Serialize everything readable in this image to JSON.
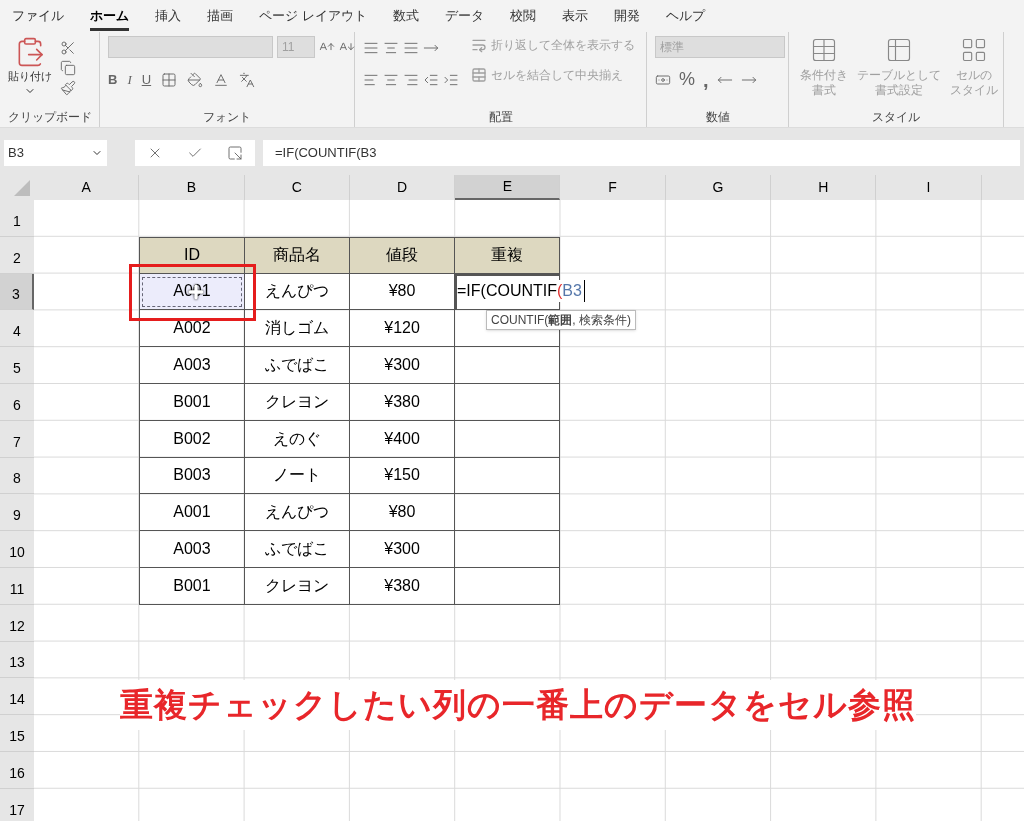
{
  "menu_tabs": [
    {
      "label": "ファイル",
      "selected": false
    },
    {
      "label": "ホーム",
      "selected": true
    },
    {
      "label": "挿入",
      "selected": false
    },
    {
      "label": "描画",
      "selected": false
    },
    {
      "label": "ページ レイアウト",
      "selected": false
    },
    {
      "label": "数式",
      "selected": false
    },
    {
      "label": "データ",
      "selected": false
    },
    {
      "label": "校閲",
      "selected": false
    },
    {
      "label": "表示",
      "selected": false
    },
    {
      "label": "開発",
      "selected": false
    },
    {
      "label": "ヘルプ",
      "selected": false
    }
  ],
  "ribbon": {
    "clipboard": {
      "paste": "貼り付け",
      "label": "クリップボード"
    },
    "font": {
      "size": "11",
      "styles": [
        "B",
        "I",
        "U"
      ],
      "label": "フォント"
    },
    "alignment": {
      "wrap": "折り返して全体を表示する",
      "merge": "セルを結合して中央揃え",
      "label": "配置"
    },
    "number": {
      "format": "標準",
      "percent": "%",
      "comma": ",",
      "label": "数値"
    },
    "styles": {
      "buttons": [
        {
          "line1": "条件付き",
          "line2": "書式"
        },
        {
          "line1": "テーブルとして",
          "line2": "書式設定"
        },
        {
          "line1": "セルの",
          "line2": "スタイル"
        }
      ],
      "label": "スタイル"
    }
  },
  "name_box": "B3",
  "formula": "=IF(COUNTIF(B3",
  "columns": [
    {
      "label": "A",
      "selected": false
    },
    {
      "label": "B",
      "selected": false
    },
    {
      "label": "C",
      "selected": false
    },
    {
      "label": "D",
      "selected": false
    },
    {
      "label": "E",
      "selected": true
    },
    {
      "label": "F",
      "selected": false
    },
    {
      "label": "G",
      "selected": false
    },
    {
      "label": "H",
      "selected": false
    },
    {
      "label": "I",
      "selected": false
    }
  ],
  "rows": [
    {
      "label": "1",
      "selected": false
    },
    {
      "label": "2",
      "selected": false
    },
    {
      "label": "3",
      "selected": true
    },
    {
      "label": "4",
      "selected": false
    },
    {
      "label": "5",
      "selected": false
    },
    {
      "label": "6",
      "selected": false
    },
    {
      "label": "7",
      "selected": false
    },
    {
      "label": "8",
      "selected": false
    },
    {
      "label": "9",
      "selected": false
    },
    {
      "label": "10",
      "selected": false
    },
    {
      "label": "11",
      "selected": false
    },
    {
      "label": "12",
      "selected": false
    },
    {
      "label": "13",
      "selected": false
    },
    {
      "label": "14",
      "selected": false
    },
    {
      "label": "15",
      "selected": false
    },
    {
      "label": "16",
      "selected": false
    },
    {
      "label": "17",
      "selected": false
    }
  ],
  "table": {
    "columns": [
      "ID",
      "商品名",
      "値段",
      "重複"
    ],
    "rows": [
      {
        "id": "A001",
        "name": "えんぴつ",
        "price": "¥80",
        "referenced": true
      },
      {
        "id": "A002",
        "name": "消しゴム",
        "price": "¥120",
        "referenced": false
      },
      {
        "id": "A003",
        "name": "ふでばこ",
        "price": "¥300",
        "referenced": false
      },
      {
        "id": "B001",
        "name": "クレヨン",
        "price": "¥380",
        "referenced": false
      },
      {
        "id": "B002",
        "name": "えのぐ",
        "price": "¥400",
        "referenced": false
      },
      {
        "id": "B003",
        "name": "ノート",
        "price": "¥150",
        "referenced": false
      },
      {
        "id": "A001",
        "name": "えんぴつ",
        "price": "¥80",
        "referenced": false
      },
      {
        "id": "A003",
        "name": "ふでばこ",
        "price": "¥300",
        "referenced": false
      },
      {
        "id": "B001",
        "name": "クレヨン",
        "price": "¥380",
        "referenced": false
      }
    ]
  },
  "editing_cell": {
    "parts": [
      {
        "kind": "text",
        "text": "=IF(COUNTIF"
      },
      {
        "kind": "paren",
        "text": "("
      },
      {
        "kind": "ref",
        "text": "B3"
      }
    ]
  },
  "tooltip": "COUNTIF(**範囲**, 検索条件)",
  "annotation": "重複チェックしたい列の一番上のデータをセル参照"
}
